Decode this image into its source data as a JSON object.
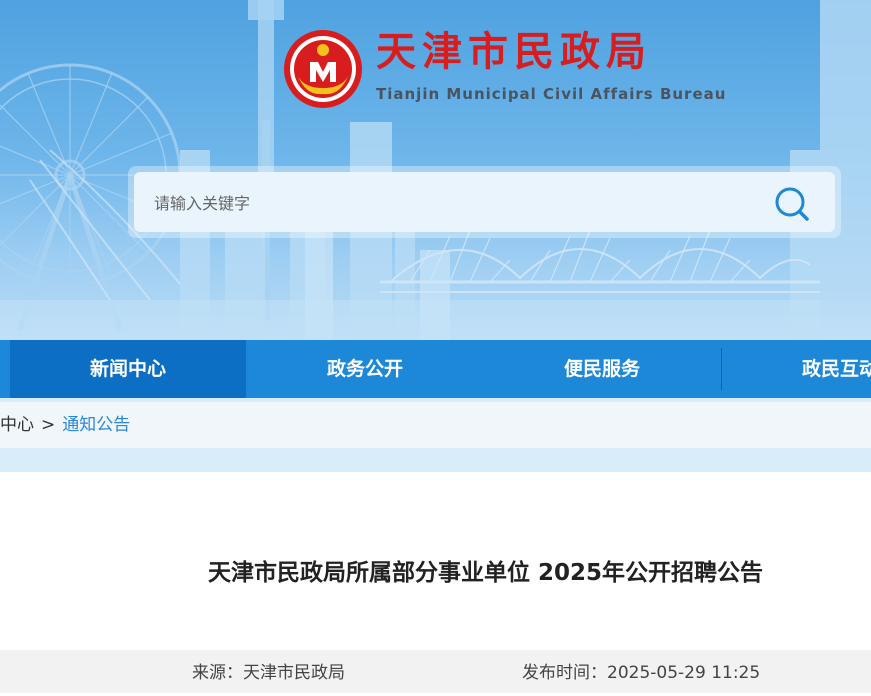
{
  "header": {
    "title": "天津市民政局",
    "subtitle": "Tianjin Municipal Civil Affairs Bureau",
    "logo_icon": "civil-affairs-emblem"
  },
  "search": {
    "placeholder": "请输入关键字",
    "icon": "search-icon"
  },
  "nav": {
    "items": [
      {
        "label": "新闻中心",
        "active": true
      },
      {
        "label": "政务公开",
        "active": false
      },
      {
        "label": "便民服务",
        "active": false
      },
      {
        "label": "政民互动",
        "active": false
      }
    ]
  },
  "breadcrumb": {
    "parent": "中心",
    "separator": ">",
    "current": "通知公告"
  },
  "article": {
    "title": "天津市民政局所属部分事业单位 2025年公开招聘公告",
    "source": "来源：天津市民政局",
    "published": "发布时间：2025-05-29 11:25"
  },
  "colors": {
    "nav": "#1e88d8",
    "nav_active": "#0d6fc4",
    "brand_red": "#d71d1d",
    "link": "#2b86d6"
  }
}
